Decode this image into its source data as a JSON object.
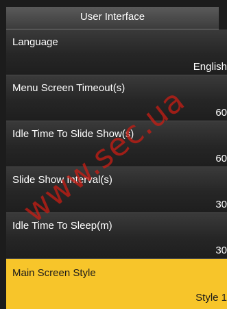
{
  "header": {
    "title": "User Interface"
  },
  "settings": [
    {
      "label": "Language",
      "value": "English"
    },
    {
      "label": "Menu Screen Timeout(s)",
      "value": "60"
    },
    {
      "label": "Idle Time To Slide Show(s)",
      "value": "60"
    },
    {
      "label": "Slide Show Interval(s)",
      "value": "30"
    },
    {
      "label": "Idle Time To Sleep(m)",
      "value": "30"
    },
    {
      "label": "Main Screen Style",
      "value": "Style 1",
      "selected": true
    }
  ],
  "watermark": "www.sec.ua",
  "colors": {
    "selected_bg": "#f7c52a",
    "background": "#1c1c1c"
  }
}
